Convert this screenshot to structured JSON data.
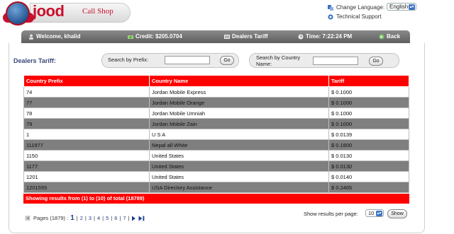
{
  "logo": {
    "brand": "jood",
    "tagline": "Call Shop"
  },
  "header": {
    "change_language_label": "Change Language:",
    "language_value": "English",
    "technical_support_label": "Technical Support"
  },
  "navbar": {
    "welcome": "Welcome, khalid",
    "credit": "Credit: $205.0704",
    "dealers_tariff": "Dealers Tariff",
    "time": "Time: 7:22:24 PM",
    "back": "Back"
  },
  "page": {
    "title": "Dealers Tariff:"
  },
  "search": {
    "prefix_label": "Search by Prefix:",
    "country_label_line1": "Search by Country",
    "country_label_line2": "Name:",
    "go_label": "Go"
  },
  "table": {
    "headers": [
      "Country Prefix",
      "Country Name",
      "Tariff"
    ],
    "rows": [
      [
        "74",
        "Jordan Mobile Express",
        "$ 0.1000"
      ],
      [
        "77",
        "Jordan Mobile Orange",
        "$ 0.1000"
      ],
      [
        "78",
        "Jordan Mobile Umniah",
        "$ 0.1000"
      ],
      [
        "79",
        "Jordan Mobile Zain",
        "$ 0.1000"
      ],
      [
        "1",
        "U S A",
        "$ 0.0139"
      ],
      [
        "111977",
        "Nepal all White",
        "$ 0.1800"
      ],
      [
        "1150",
        "United States",
        "$ 0.0130"
      ],
      [
        "1177",
        "United States",
        "$ 0.0130"
      ],
      [
        "1201",
        "United States",
        "$ 0.0140"
      ],
      [
        "1201555",
        "USA Directory Assistance",
        "$ 0.2465"
      ]
    ],
    "summary": "Showing results from (1) to (10) of total (18789)"
  },
  "pager": {
    "pages_label": "Pages (1879) :",
    "current": "1",
    "pages": [
      "2",
      "3",
      "4",
      "5",
      "6",
      "7"
    ]
  },
  "per_page": {
    "label": "Show results per page:",
    "value": "10",
    "button": "Show"
  },
  "colors": {
    "table_header": "#ff0000",
    "even_row": "#7f7f7f",
    "navbar": "#6e6e6e",
    "brand_red": "#c8102e"
  }
}
